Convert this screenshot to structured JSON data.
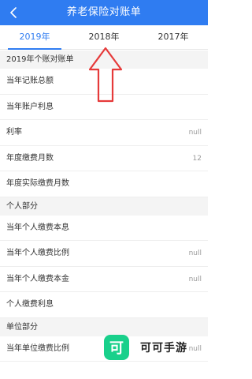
{
  "header": {
    "title": "养老保险对账单"
  },
  "tabs": [
    {
      "label": "2019年",
      "active": true
    },
    {
      "label": "2018年",
      "active": false
    },
    {
      "label": "2017年",
      "active": false
    }
  ],
  "sections": [
    {
      "title": "2019年个账对账单",
      "rows": [
        {
          "label": "当年记账总额",
          "value": ""
        },
        {
          "label": "当年账户利息",
          "value": ""
        },
        {
          "label": "利率",
          "value": "null"
        },
        {
          "label": "年度缴费月数",
          "value": "12"
        },
        {
          "label": "年度实际缴费月数",
          "value": ""
        }
      ]
    },
    {
      "title": "个人部分",
      "rows": [
        {
          "label": "当年个人缴费本息",
          "value": ""
        },
        {
          "label": "当年个人缴费比例",
          "value": "null"
        },
        {
          "label": "当年个人缴费本金",
          "value": "null"
        },
        {
          "label": "个人缴费利息",
          "value": ""
        }
      ]
    },
    {
      "title": "单位部分",
      "rows": [
        {
          "label": "当年单位缴费比例",
          "value": "null"
        }
      ]
    }
  ],
  "watermark": {
    "logo_char": "可",
    "text": "可可手游"
  },
  "colors": {
    "accent": "#2f7cf1",
    "arrow": "#e63a3a",
    "watermark": "#19d08b"
  },
  "icons": {
    "back": "chevron-left-icon",
    "annotation": "up-arrow-annotation"
  }
}
